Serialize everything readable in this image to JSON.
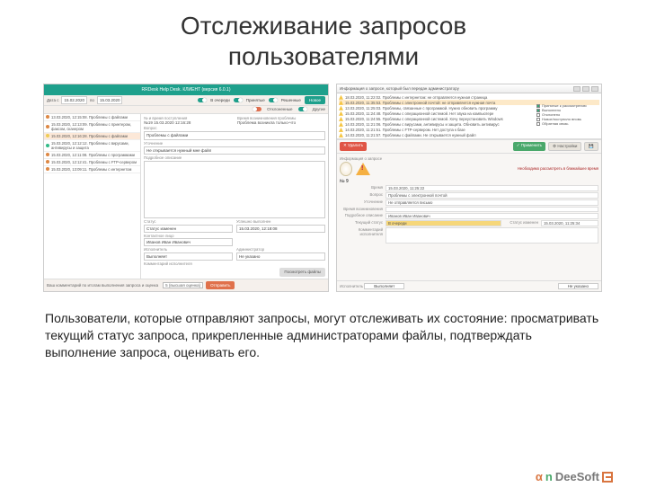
{
  "title_line1": "Отслеживание запросов",
  "title_line2": "пользователями",
  "description": "Пользователи, которые отправляют запросы, могут отслеживать их состояние: просматривать текущий статус запроса, прикрепленные администраторами файлы, подтверждать выполнение запроса, оценивать его.",
  "logo": {
    "a": "α",
    "n": "n",
    "rest": "DeeSoft"
  },
  "left": {
    "window_title": "RRDesk Help Desk. КЛИЕНТ (версия 6.0.1)",
    "date_from_label": "Дата с",
    "date_from": "15.02.2020",
    "date_to_label": "по",
    "date_to": "15.03.2020",
    "filters": {
      "queue": "В очереди",
      "accepted": "Принятые",
      "resolved": "Решенные",
      "more": "Новое",
      "rejected": "Отклоненные",
      "other": "Другие"
    },
    "list": [
      {
        "t": "13.03.2020, 12:15:08. Проблемы с файлами",
        "c": "red"
      },
      {
        "t": "15.03.2020, 12:13:09. Проблемы с принтером, факсом, сканером",
        "c": "red"
      },
      {
        "t": "15.03.2020, 12:16:28. Проблемы с файлами",
        "c": "yel",
        "sel": true
      },
      {
        "t": "15.03.2020, 12:12:12. Проблемы с вирусами, антивирусы и защита",
        "c": "grn"
      },
      {
        "t": "15.03.2020, 12:11:08. Проблемы с программами",
        "c": "red"
      },
      {
        "t": "15.03.2020, 12:12:41. Проблемы с FTP-сервером",
        "c": "red"
      },
      {
        "t": "15.03.2020, 13:09:11. Проблемы с интернетом",
        "c": "red"
      }
    ],
    "detail": {
      "num_time_label": "№ и время поступления",
      "num_time": "№19  15.03.2020  12:16:28",
      "occur_label": "Время возникновения проблемы",
      "occur": "Проблема возникла только-что",
      "subject_label": "Вопрос",
      "subject": "Проблемы с файлами",
      "clarify_label": "Уточнение",
      "clarify": "Не открывается нужный мне файл",
      "desc_label": "Подробное описание",
      "status_label": "Статус",
      "status": "Статус изменен",
      "done_label": "Успешно выполнен",
      "done": "15.03.2020, 12:18:08",
      "contact_label": "Контактное лицо",
      "contact": "Иванов Иван Иванович",
      "executor_label": "Исполнитель",
      "executor": "Выполняет",
      "admin_label": "Администратор",
      "admin": "Не указано",
      "comment_label": "Комментарий исполнителя",
      "view_files": "Посмотреть файлы"
    },
    "footer": {
      "hint": "Ваш комментарий по итогам выполнения запроса и оценка",
      "rating": "5 (высшая оценка)",
      "send": "Отправить"
    }
  },
  "right": {
    "window_title": "Информация о запросе, который был передан администратору",
    "issues": [
      "18.03.2020, 11:22:02. Проблемы с интернетом: не отправляется нужная страница",
      "15.03.2020, 11:35:53. Проблемы с электронной почтой: не отправляется нужная почта",
      "13.03.2020, 11:25:03. Проблемы, связанные с программой. Нужно обновить программу",
      "15.03.2020, 11:24:48. Проблемы с операционной системой. Нет звука на компьютере",
      "15.03.2020, 11:24:55. Проблемы с операционной системой. Хочу переустановить Windows",
      "14.03.2020, 11:21:06. Проблемы с вирусами, антивирусы и защита. Обновить антивирус",
      "14.03.2020, 11:21:51. Проблемы с FTP-сервером. Нет доступа к базе",
      "14.03.2020, 11:21:57. Проблемы с файлами. Не открывается нужный файл"
    ],
    "side": {
      "p1": "Принятые к рассмотрению",
      "p2": "Выполнено",
      "p3": "Отклонено",
      "p4": "Новое/поступило вновь",
      "p5": "Обратная связь"
    },
    "actions": {
      "del": "Удалить",
      "apply": "Применить",
      "settings": "Настройки"
    },
    "info_header": "Информация о запросе",
    "priority_note": "Необходимо рассмотреть в ближайшее время",
    "num_label": "№ 9",
    "kv": {
      "time": {
        "k": "Время",
        "v": "15.03.2020, 11:25:22"
      },
      "subject": {
        "k": "Вопрос",
        "v": "Проблемы с электронной почтой"
      },
      "clarify": {
        "k": "Уточнение",
        "v": "Не отправляется письмо"
      },
      "occur": {
        "k": "Время возникновения",
        "v": ""
      },
      "desc": {
        "k": "Подробное описание",
        "v": "Иванов Иван Иванович"
      },
      "status": {
        "k": "Текущий статус",
        "v": "В очереди"
      },
      "changed": {
        "k": "Статус изменен",
        "v": "15.03.2020, 11:25:34"
      },
      "comment": {
        "k": "Комментарий исполнителя",
        "v": ""
      }
    },
    "bottom": {
      "exec_label": "Исполнитель",
      "exec": "Выполняет",
      "val_label": "Не указано"
    }
  }
}
